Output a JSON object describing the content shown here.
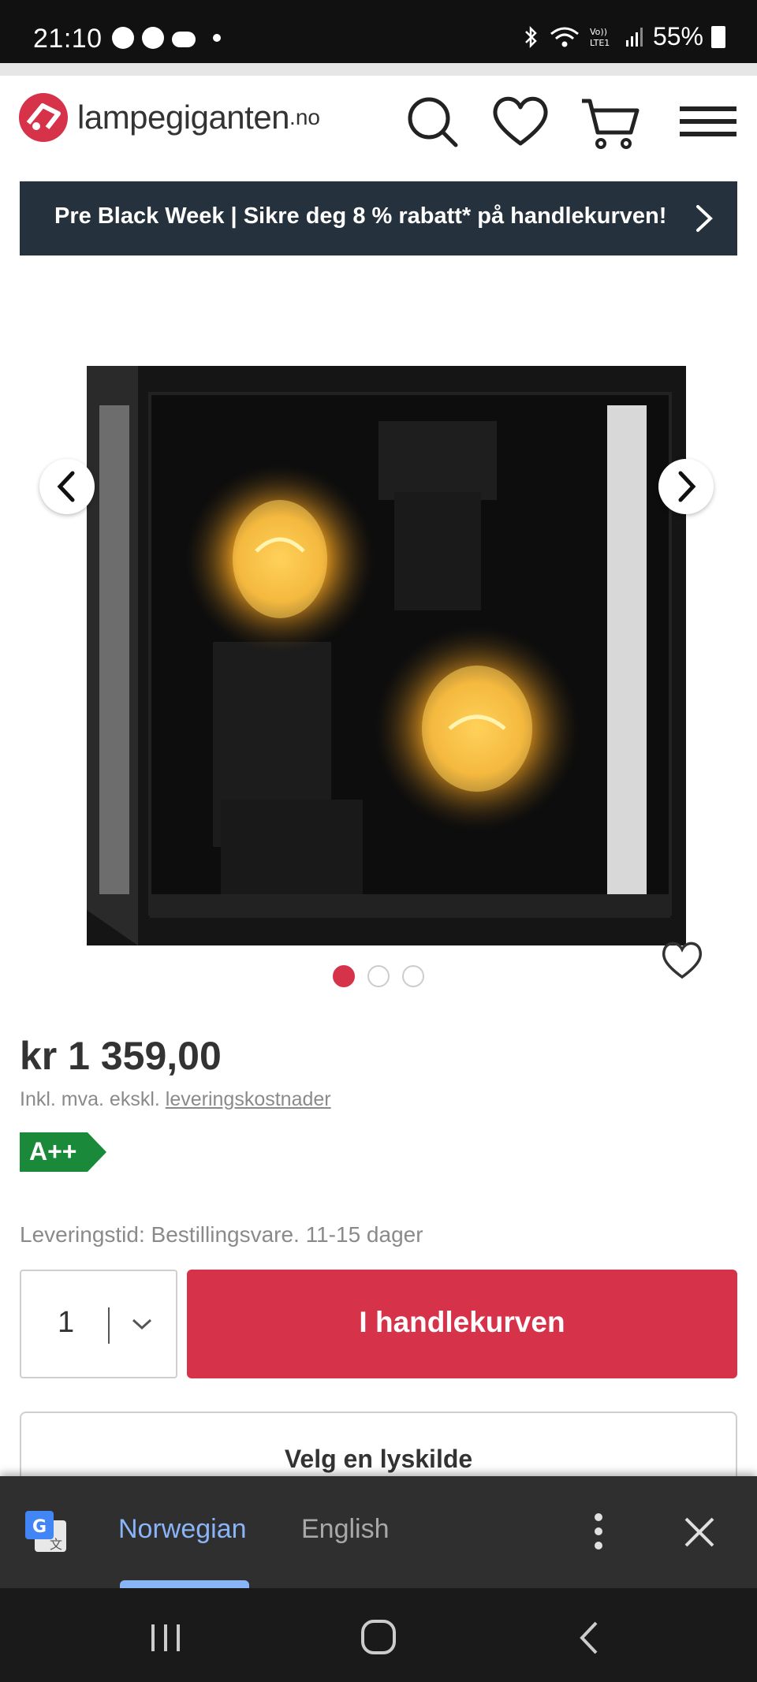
{
  "status_bar": {
    "time": "21:10",
    "battery": "55%"
  },
  "header": {
    "logo_text": "lampegiganten",
    "logo_tld": ".no",
    "icons": [
      "search-icon",
      "heart-icon",
      "cart-icon",
      "menu-icon"
    ]
  },
  "promo": {
    "text": "Pre Black Week | Sikre deg 8 % rabatt* på handlekurven!"
  },
  "gallery": {
    "image_count": 3,
    "active_index": 0
  },
  "product": {
    "price": "kr 1 359,00",
    "vat_prefix": "Inkl. mva. ekskl. ",
    "vat_link": "leveringskostnader",
    "energy_class": "A++",
    "delivery": "Leveringstid: Bestillingsvare. 11-15 dager",
    "quantity": "1",
    "add_to_cart": "I handlekurven",
    "choose_light": "Velg en lyskilde"
  },
  "translate_bar": {
    "tab_source": "Norwegian",
    "tab_target": "English"
  },
  "colors": {
    "brand_red": "#d6334b",
    "banner_dark": "#25313c",
    "energy_green": "#1a8a3a",
    "translate_blue": "#8ab4f8"
  }
}
